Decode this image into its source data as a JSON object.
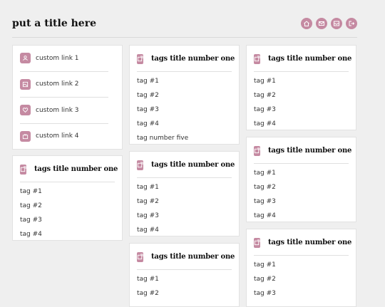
{
  "header": {
    "title": "put a title here",
    "icons": [
      "home-icon",
      "mail-icon",
      "inbox-icon",
      "logout-icon"
    ]
  },
  "links": [
    {
      "label": "custom link 1",
      "icon": "user-icon"
    },
    {
      "label": "custom link 2",
      "icon": "image-icon"
    },
    {
      "label": "custom link 3",
      "icon": "heart-icon"
    },
    {
      "label": "custom link 4",
      "icon": "tv-icon"
    }
  ],
  "tag_cards": [
    {
      "title": "tags title number one",
      "tags": [
        "tag #1",
        "tag #2",
        "tag #3",
        "tag #4"
      ]
    },
    {
      "title": "tags title number one",
      "tags": [
        "tag #1",
        "tag #2",
        "tag #3",
        "tag #4",
        "tag number five"
      ]
    },
    {
      "title": "tags title number one",
      "tags": [
        "tag #1",
        "tag #2",
        "tag #3",
        "tag #4"
      ]
    },
    {
      "title": "tags title number one",
      "tags": [
        "tag #1",
        "tag #2"
      ]
    },
    {
      "title": "tags title number one",
      "tags": [
        "tag #1",
        "tag #2",
        "tag #3",
        "tag #4"
      ]
    },
    {
      "title": "tags title number one",
      "tags": [
        "tag #1",
        "tag #2",
        "tag #3",
        "tag #4"
      ]
    },
    {
      "title": "tags title number one",
      "tags": [
        "tag #1",
        "tag #2",
        "tag #3"
      ]
    }
  ],
  "colors": {
    "accent": "#c58aa2",
    "background": "#efefef"
  }
}
